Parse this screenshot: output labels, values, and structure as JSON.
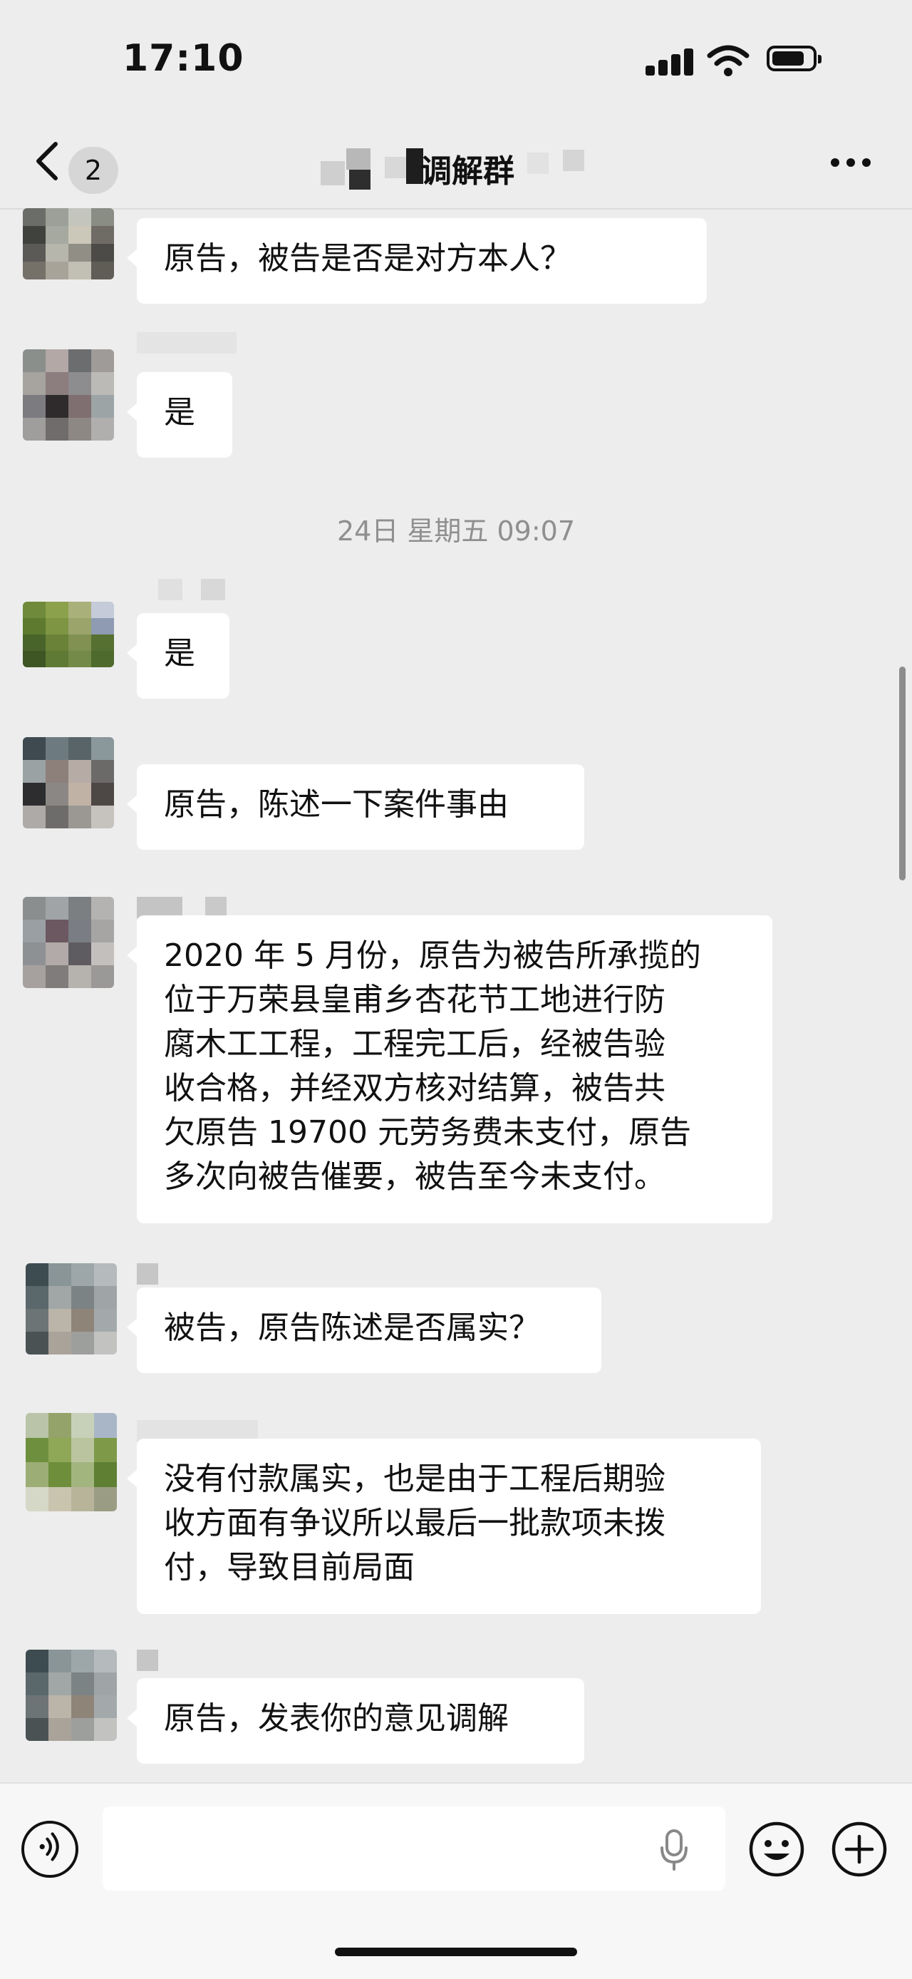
{
  "status_bar": {
    "time": "17:10"
  },
  "nav": {
    "back_count": "2",
    "title": "调解群"
  },
  "messages": [
    {
      "text": "原告，被告是否是对方本人？"
    },
    {
      "text": "是"
    },
    {
      "text": "是"
    },
    {
      "text": "原告，陈述一下案件事由"
    },
    {
      "lines": [
        "2020 年 5 月份，原告为被告所承揽的",
        "位于万荣县皇甫乡杏花节工地进行防",
        "腐木工工程，工程完工后，经被告验",
        "收合格，并经双方核对结算，被告共",
        "欠原告 19700 元劳务费未支付，原告",
        "多次向被告催要，被告至今未支付。"
      ]
    },
    {
      "text": "被告，原告陈述是否属实？"
    },
    {
      "lines": [
        "没有付款属实，也是由于工程后期验",
        "收方面有争议所以最后一批款项未拨",
        "付，导致目前局面"
      ]
    },
    {
      "text": "原告，发表你的意见调解"
    }
  ],
  "timestamp": "24日 星期五 09:07",
  "colors": {
    "background": "#ededed",
    "bubble": "#ffffff",
    "timestamp": "#8f8f8f"
  }
}
